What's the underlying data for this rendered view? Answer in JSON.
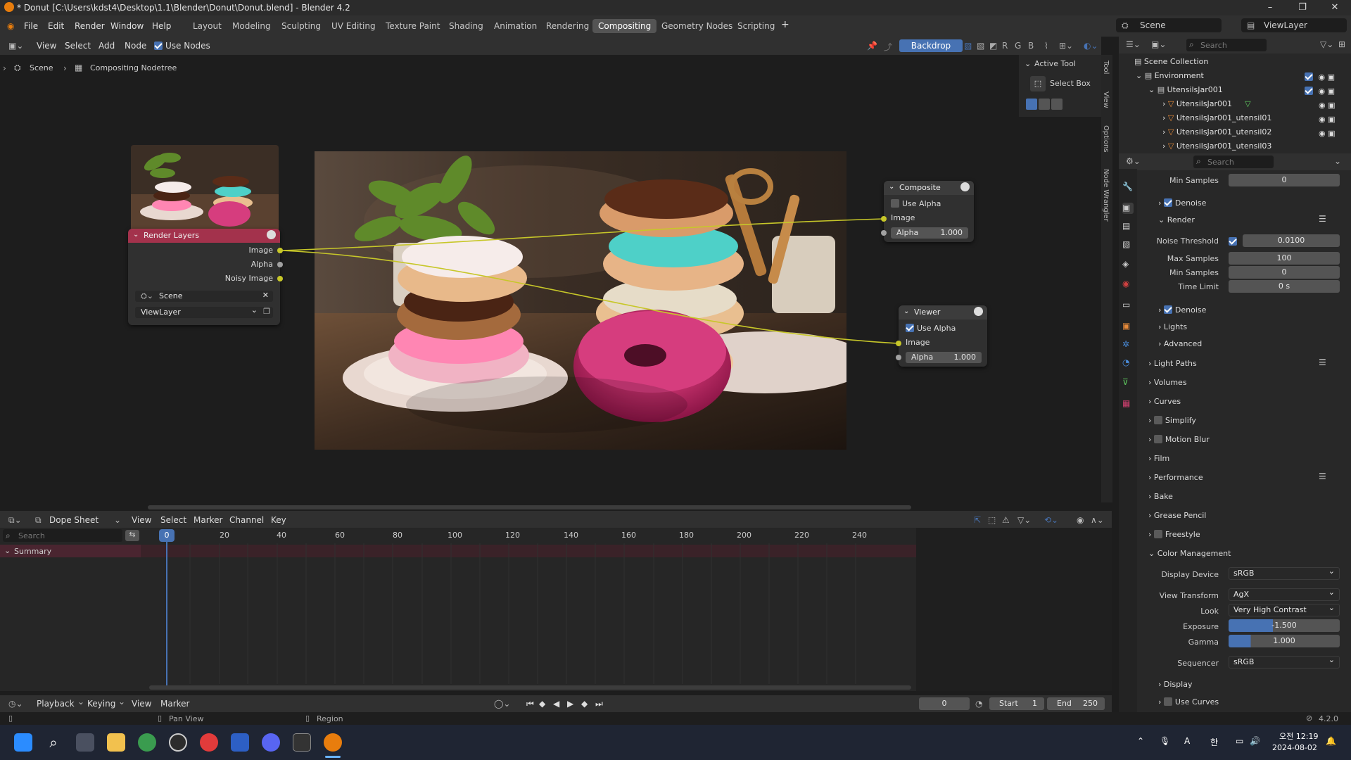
{
  "window": {
    "title": "* Donut [C:\\Users\\kdst4\\Desktop\\1.1\\Blender\\Donut\\Donut.blend] - Blender 4.2"
  },
  "menu": {
    "items": [
      "File",
      "Edit",
      "Render",
      "Window",
      "Help"
    ],
    "workspaces": [
      "Layout",
      "Modeling",
      "Sculpting",
      "UV Editing",
      "Texture Paint",
      "Shading",
      "Animation",
      "Rendering",
      "Compositing",
      "Geometry Nodes",
      "Scripting"
    ],
    "active_workspace": "Compositing",
    "scene": "Scene",
    "view_layer": "ViewLayer"
  },
  "node_editor": {
    "header": {
      "view": "View",
      "select": "Select",
      "add": "Add",
      "node": "Node",
      "use_nodes": "Use Nodes",
      "backdrop": "Backdrop",
      "channels": [
        "R",
        "G",
        "B"
      ]
    },
    "breadcrumb": [
      "Scene",
      "Compositing Nodetree"
    ],
    "render_layers": {
      "title": "Render Layers",
      "outputs": [
        "Image",
        "Alpha",
        "Noisy Image"
      ],
      "scene": "Scene",
      "view_layer": "ViewLayer"
    },
    "composite": {
      "title": "Composite",
      "use_alpha": "Use Alpha",
      "image": "Image",
      "alpha_label": "Alpha",
      "alpha_value": "1.000"
    },
    "viewer": {
      "title": "Viewer",
      "use_alpha": "Use Alpha",
      "image": "Image",
      "alpha_label": "Alpha",
      "alpha_value": "1.000"
    },
    "sidebar": {
      "active_tool": "Active Tool",
      "select_box": "Select Box",
      "tabs": [
        "Tool",
        "View",
        "Options",
        "Node Wrangler"
      ]
    }
  },
  "dope_sheet": {
    "mode": "Dope Sheet",
    "menus": [
      "View",
      "Select",
      "Marker",
      "Channel",
      "Key"
    ],
    "search_placeholder": "Search",
    "summary": "Summary",
    "current_frame": "0",
    "ticks": [
      "20",
      "40",
      "60",
      "80",
      "100",
      "120",
      "140",
      "160",
      "180",
      "200",
      "220",
      "240"
    ]
  },
  "timeline": {
    "playback": "Playback",
    "keying": "Keying",
    "view": "View",
    "marker": "Marker",
    "frame": "0",
    "start_label": "Start",
    "start": "1",
    "end_label": "End",
    "end": "250"
  },
  "status": {
    "pan": "Pan View",
    "region": "Region",
    "version": "4.2.0"
  },
  "outliner": {
    "search_placeholder": "Search",
    "rows": [
      "Scene Collection",
      "Environment",
      "UtensilsJar001",
      "UtensilsJar001",
      "UtensilsJar001_utensil01",
      "UtensilsJar001_utensil02",
      "UtensilsJar001_utensil03"
    ]
  },
  "properties": {
    "search_placeholder": "Search",
    "min_samples_label": "Min Samples",
    "min_samples": "0",
    "denoise": "Denoise",
    "render_section": "Render",
    "noise_threshold_label": "Noise Threshold",
    "noise_threshold": "0.0100",
    "max_samples_label": "Max Samples",
    "max_samples": "100",
    "min_samples2": "0",
    "time_limit_label": "Time Limit",
    "time_limit": "0 s",
    "denoise2": "Denoise",
    "lights": "Lights",
    "advanced": "Advanced",
    "sections": [
      "Light Paths",
      "Volumes",
      "Curves",
      "Simplify",
      "Motion Blur",
      "Film",
      "Performance",
      "Bake",
      "Grease Pencil",
      "Freestyle",
      "Color Management"
    ],
    "display_device_label": "Display Device",
    "display_device": "sRGB",
    "view_transform_label": "View Transform",
    "view_transform": "AgX",
    "look_label": "Look",
    "look": "Very High Contrast",
    "exposure_label": "Exposure",
    "exposure": "-1.500",
    "gamma_label": "Gamma",
    "gamma": "1.000",
    "sequencer_label": "Sequencer",
    "sequencer": "sRGB",
    "display": "Display",
    "use_curves": "Use Curves"
  },
  "taskbar": {
    "time": "오전 12:19",
    "date": "2024-08-02",
    "ime_a": "A",
    "ime_han": "한"
  }
}
